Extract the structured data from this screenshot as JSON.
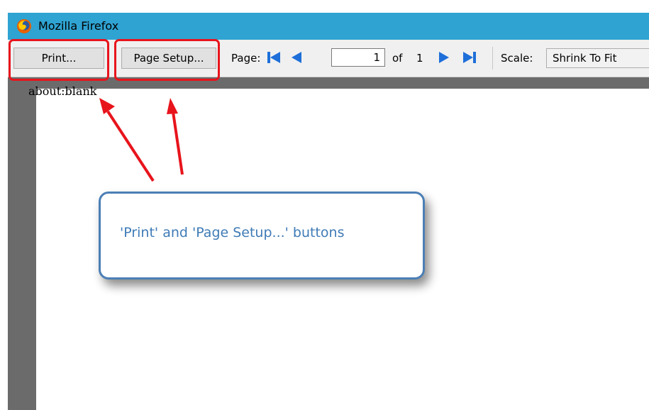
{
  "window": {
    "title": "Mozilla Firefox"
  },
  "toolbar": {
    "print_label": "Print...",
    "page_setup_label": "Page Setup...",
    "page_label": "Page:",
    "page_value": "1",
    "of_label": "of",
    "total_pages": "1",
    "scale_label": "Scale:",
    "scale_value": "Shrink To Fit"
  },
  "preview": {
    "page_text": "about:blank"
  },
  "annotation": {
    "callout_text": "'Print' and 'Page Setup...' buttons",
    "highlight_color": "#e8141c",
    "callout_color": "#4b7fb5"
  },
  "colors": {
    "titlebar": "#2fa3d2",
    "nav_icons": "#1e6fd9"
  },
  "icons": [
    "firefox-logo",
    "first-page-icon",
    "prev-page-icon",
    "next-page-icon",
    "last-page-icon"
  ]
}
